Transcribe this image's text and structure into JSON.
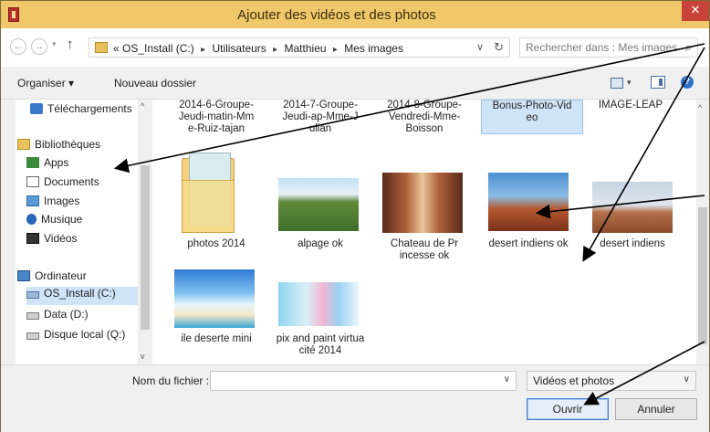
{
  "window": {
    "title": "Ajouter des vidéos et des photos",
    "close_glyph": "✕"
  },
  "address": {
    "back_glyph": "←",
    "forward_glyph": "→",
    "recent_glyph": "▾",
    "up_glyph": "↑",
    "overflow": "«",
    "crumbs": [
      "OS_Install (C:)",
      "Utilisateurs",
      "Matthieu",
      "Mes images"
    ],
    "separator": "▸",
    "dropdown_glyph": "∨",
    "refresh_glyph": "↻",
    "search_placeholder": "Rechercher dans : Mes images",
    "search_glyph": "⌕"
  },
  "toolbar": {
    "organise_label": "Organiser ▾",
    "new_folder_label": "Nouveau dossier",
    "view_dd_glyph": "▾",
    "help_glyph": "?"
  },
  "nav": {
    "items": [
      {
        "label": "Téléchargements",
        "icon": "download-icon"
      },
      {
        "label": "Bibliothèques",
        "icon": "library-icon"
      },
      {
        "label": "Apps",
        "icon": "apps-icon"
      },
      {
        "label": "Documents",
        "icon": "documents-icon"
      },
      {
        "label": "Images",
        "icon": "images-icon"
      },
      {
        "label": "Musique",
        "icon": "music-icon"
      },
      {
        "label": "Vidéos",
        "icon": "videos-icon"
      },
      {
        "label": "Ordinateur",
        "icon": "computer-icon"
      },
      {
        "label": "OS_Install (C:)",
        "icon": "drive-icon"
      },
      {
        "label": "Data (D:)",
        "icon": "drive-icon"
      },
      {
        "label": "Disque local (Q:)",
        "icon": "drive-icon"
      }
    ],
    "up_glyph": "^",
    "down_glyph": "v"
  },
  "files": {
    "top_row": [
      "2014-6-Groupe-Jeudi-matin-Mme-Ruiz-tajan",
      "2014-7-Groupe-Jeudi-ap-Mme-Julian",
      "2014-8-Groupe-Vendredi-Mme-Boisson",
      "Bonus-Photo-Video",
      "IMAGE-LEAP"
    ],
    "row2": [
      "photos 2014",
      "alpage ok",
      "Chateau de Princesse ok",
      "desert indiens ok",
      "desert indiens"
    ],
    "row3": [
      "ile deserte mini",
      "pix and paint virtuacité 2014"
    ],
    "scroll_up_glyph": "^"
  },
  "bottom": {
    "filename_label": "Nom du fichier :",
    "filename_value": "",
    "filename_dd_glyph": "∨",
    "filter_value": "Vidéos et photos",
    "filter_dd_glyph": "∨",
    "open_label": "Ouvrir",
    "cancel_label": "Annuler"
  },
  "colors": {
    "titlebar": "#f0c86a",
    "close": "#c8443a",
    "selection": "#cfe4f7",
    "accent": "#3d7bd6"
  }
}
